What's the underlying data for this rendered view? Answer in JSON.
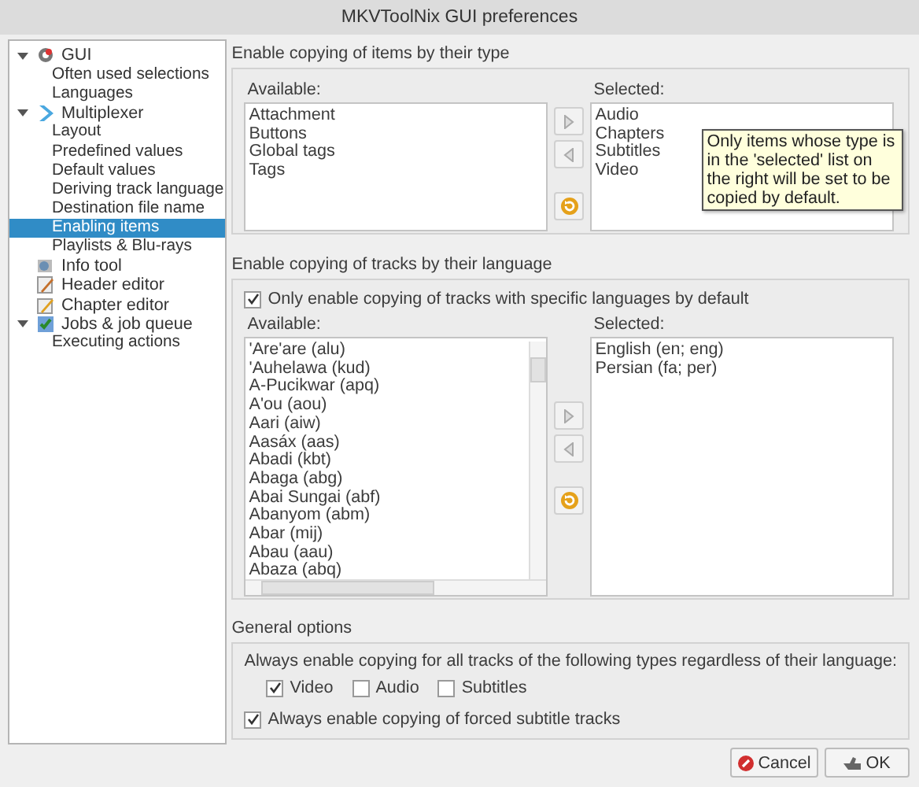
{
  "window": {
    "title": "MKVToolNix GUI preferences"
  },
  "sidebar": {
    "items": [
      {
        "label": "GUI",
        "expanded": true,
        "selected": false,
        "children": [
          {
            "label": "Often used selections",
            "selected": false
          },
          {
            "label": "Languages",
            "selected": false
          }
        ]
      },
      {
        "label": "Multiplexer",
        "expanded": true,
        "selected": false,
        "children": [
          {
            "label": "Layout",
            "selected": false
          },
          {
            "label": "Predefined values",
            "selected": false
          },
          {
            "label": "Default values",
            "selected": false
          },
          {
            "label": "Deriving track language",
            "selected": false
          },
          {
            "label": "Destination file name",
            "selected": false
          },
          {
            "label": "Enabling items",
            "selected": true
          },
          {
            "label": "Playlists & Blu-rays",
            "selected": false
          }
        ]
      },
      {
        "label": "Info tool",
        "selected": false
      },
      {
        "label": "Header editor",
        "selected": false
      },
      {
        "label": "Chapter editor",
        "selected": false
      },
      {
        "label": "Jobs & job queue",
        "expanded": true,
        "selected": false,
        "children": [
          {
            "label": "Executing actions",
            "selected": false
          }
        ]
      }
    ]
  },
  "item_types": {
    "title": "Enable copying of items by their type",
    "available_label": "Available:",
    "available": [
      "Attachment",
      "Buttons",
      "Global tags",
      "Tags"
    ],
    "selected_label": "Selected:",
    "selected": [
      "Audio",
      "Chapters",
      "Subtitles",
      "Video"
    ],
    "tooltip": "Only items whose type is in the 'selected' list on the right will be set to be copied by default."
  },
  "languages": {
    "title": "Enable copying of tracks by their language",
    "only_specific": {
      "label": "Only enable copying of tracks with specific languages by default",
      "checked": true
    },
    "available_label": "Available:",
    "available": [
      "'Are'are (alu)",
      "'Auhelawa (kud)",
      "A-Pucikwar (apq)",
      "A'ou (aou)",
      "Aari (aiw)",
      "Aasáx (aas)",
      "Abadi (kbt)",
      "Abaga (abg)",
      "Abai Sungai (abf)",
      "Abanyom (abm)",
      "Abar (mij)",
      "Abau (aau)",
      "Abaza (abq)"
    ],
    "selected_label": "Selected:",
    "selected": [
      "English (en; eng)",
      "Persian (fa; per)"
    ]
  },
  "general": {
    "title": "General options",
    "types_label": "Always enable copying for all tracks of the following types regardless of their language:",
    "types": [
      {
        "label": "Video",
        "checked": true
      },
      {
        "label": "Audio",
        "checked": false
      },
      {
        "label": "Subtitles",
        "checked": false
      }
    ],
    "forced": {
      "label": "Always enable copying of forced subtitle tracks",
      "checked": true
    }
  },
  "buttons": [
    {
      "label": "Cancel",
      "kind": "cancel"
    },
    {
      "label": "OK",
      "kind": "ok"
    }
  ]
}
